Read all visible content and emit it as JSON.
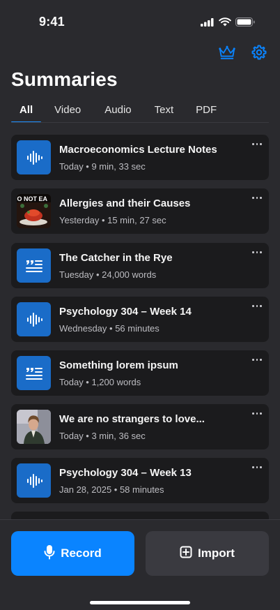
{
  "status_bar": {
    "time": "9:41"
  },
  "header": {
    "title": "Summaries"
  },
  "tabs": [
    "All",
    "Video",
    "Audio",
    "Text",
    "PDF"
  ],
  "items": [
    {
      "title": "Macroeconomics Lecture Notes",
      "meta": "Today • 9 min, 33 sec",
      "thumb": "waveform-icon"
    },
    {
      "title": "Allergies and their Causes",
      "meta": "Yesterday • 15 min, 27 sec",
      "thumb": "video-thumbnail",
      "thumb_text": "O NOT EA"
    },
    {
      "title": "The Catcher in the Rye",
      "meta": "Tuesday • 24,000 words",
      "thumb": "quote-text-icon"
    },
    {
      "title": "Psychology 304 – Week 14",
      "meta": "Wednesday • 56 minutes",
      "thumb": "waveform-icon"
    },
    {
      "title": "Something lorem ipsum",
      "meta": "Today • 1,200 words",
      "thumb": "quote-text-icon"
    },
    {
      "title": "We are no strangers to love...",
      "meta": "Today • 3 min, 36 sec",
      "thumb": "video-thumbnail"
    },
    {
      "title": "Psychology 304 – Week 13",
      "meta": "Jan 28, 2025 • 58 minutes",
      "thumb": "waveform-icon"
    }
  ],
  "actions": {
    "record_label": "Record",
    "import_label": "Import"
  },
  "colors": {
    "accent": "#0a84ff",
    "thumb_blue": "#1a6cc8",
    "background": "#2a2a2e",
    "card": "#1b1b1d"
  }
}
